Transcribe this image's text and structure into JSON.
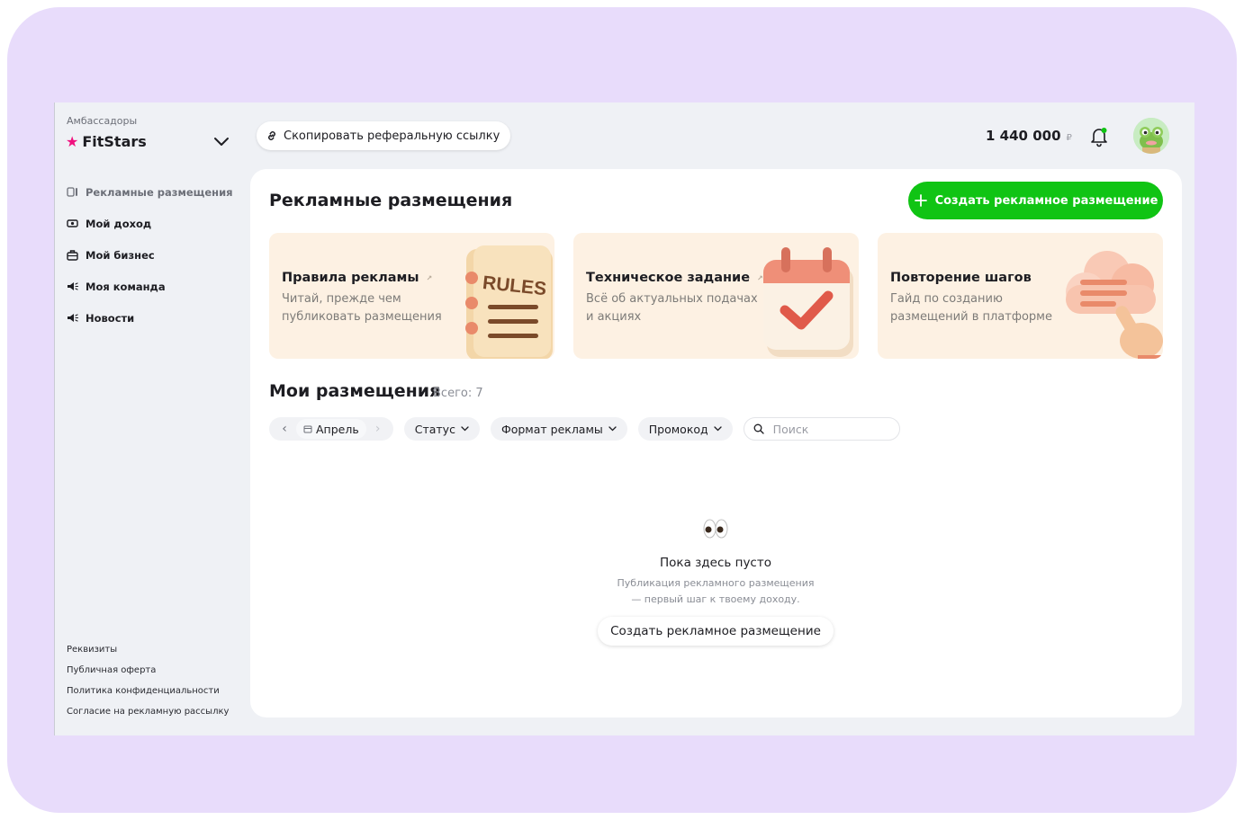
{
  "sidebar": {
    "brand_caption": "Амбассадоры",
    "brand_name": "FitStars",
    "nav": [
      {
        "label": "Рекламные размещения",
        "icon": "ad-placement-icon",
        "active": true
      },
      {
        "label": "Мой доход",
        "icon": "income-icon"
      },
      {
        "label": "Мой бизнес",
        "icon": "business-icon"
      },
      {
        "label": "Моя команда",
        "icon": "team-icon"
      },
      {
        "label": "Новости",
        "icon": "news-icon"
      }
    ],
    "footer_links": [
      "Реквизиты",
      "Публичная оферта",
      "Политика конфиденциальности",
      "Согласие на рекламную рассылку"
    ]
  },
  "topbar": {
    "copy_link_label": "Скопировать реферальную ссылку",
    "balance": "1 440 000",
    "currency": "₽"
  },
  "main": {
    "title": "Рекламные размещения",
    "create_button": "Создать рекламное размещение",
    "cards": [
      {
        "title": "Правила рекламы",
        "text": "Читай, прежде чем публиковать размещения",
        "illustration": "rules-notebook-icon",
        "badge_text": "RULES"
      },
      {
        "title": "Техническое задание",
        "text": "Всё об актуальных подачах и акциях",
        "illustration": "calendar-check-icon"
      },
      {
        "title": "Повторение шагов",
        "text": "Гайд по созданию размещений в платформе",
        "illustration": "cloud-hand-icon"
      }
    ],
    "my_title": "Мои размещения",
    "my_count": "Всего: 7",
    "filters": {
      "month": "Апрель",
      "status": "Статус",
      "format": "Формат рекламы",
      "promo": "Промокод",
      "search_placeholder": "Поиск"
    },
    "empty": {
      "title": "Пока здесь пусто",
      "line1": "Публикация рекламного размещения",
      "line2": "— первый шаг к твоему доходу.",
      "button": "Создать рекламное размещение"
    }
  },
  "colors": {
    "accent_green": "#10c414",
    "brand_pink": "#f0107e",
    "card_bg": "#fdf1e3",
    "frame_purple": "#e8dcfb"
  }
}
